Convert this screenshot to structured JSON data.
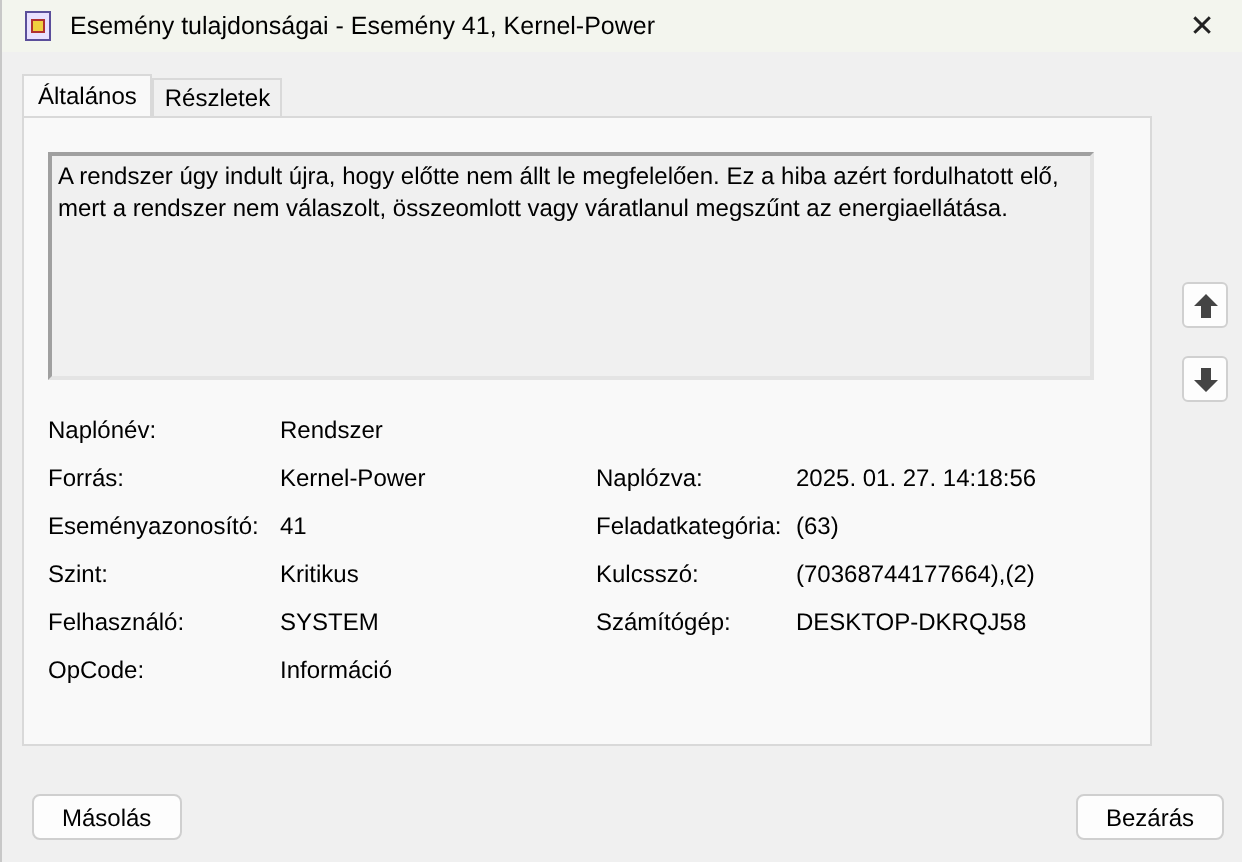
{
  "window": {
    "title": "Esemény tulajdonságai - Esemény 41, Kernel-Power",
    "close": "✕"
  },
  "tabs": [
    {
      "label": "Általános",
      "selected": true
    },
    {
      "label": "Részletek",
      "selected": false
    }
  ],
  "description": "A rendszer úgy indult újra, hogy előtte nem állt le megfelelően. Ez a hiba azért fordulhatott elő, mert a rendszer nem válaszolt, összeomlott vagy váratlanul megszűnt az energiaellátása.",
  "rows": [
    {
      "label": "Naplónév:",
      "value": "Rendszer"
    },
    {
      "label": "Forrás:",
      "value": "Kernel-Power",
      "right_label": "Naplózva:",
      "right_value": "2025. 01. 27. 14:18:56"
    },
    {
      "label": "Eseményazonosító:",
      "value": "41",
      "right_label": "Feladatkategória:",
      "right_value": "(63)"
    },
    {
      "label": "Szint:",
      "value": "Kritikus",
      "right_label": "Kulcsszó:",
      "right_value": "(70368744177664),(2)"
    },
    {
      "label": "Felhasználó:",
      "value": "SYSTEM",
      "right_label": "Számítógép:",
      "right_value": "DESKTOP-DKRQJ58"
    },
    {
      "label": "OpCode:",
      "value": "Információ"
    }
  ],
  "buttons": [
    {
      "label": "Másolás"
    },
    {
      "label": "Bezárás"
    }
  ]
}
